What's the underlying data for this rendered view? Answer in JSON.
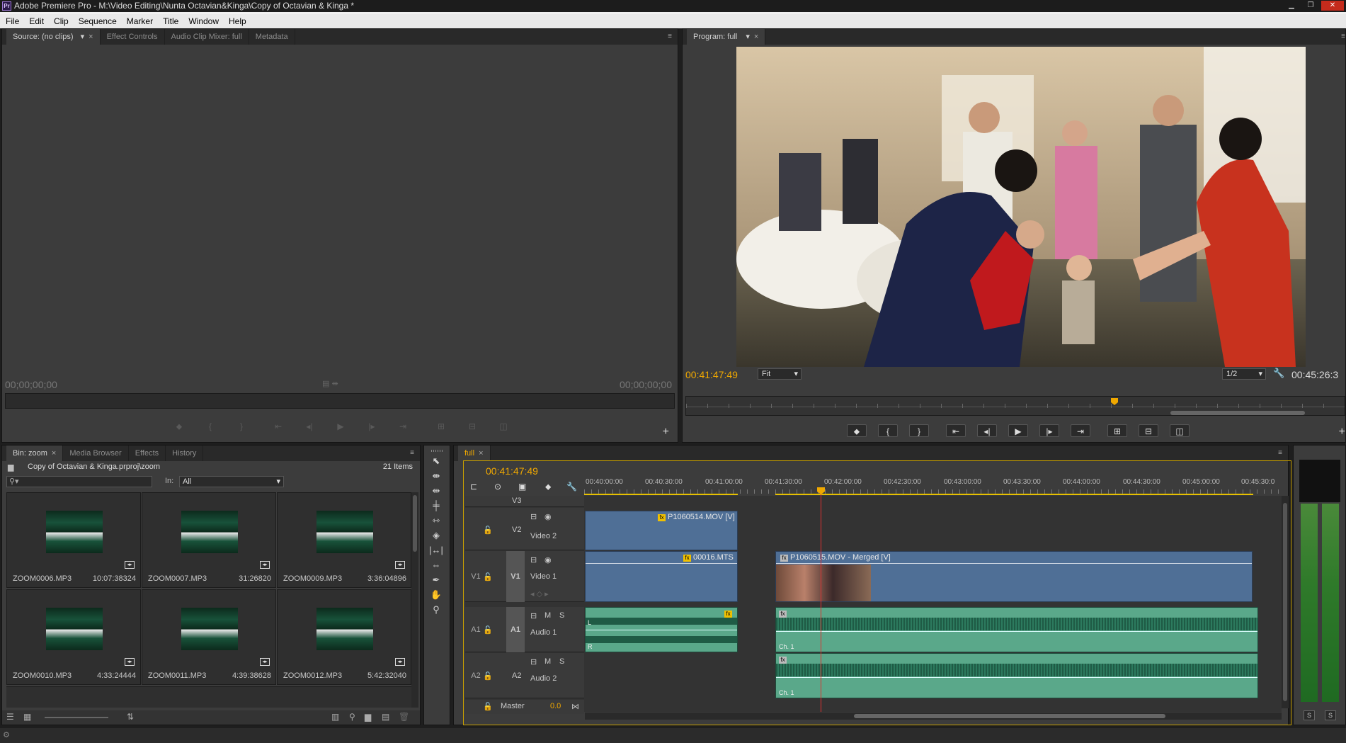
{
  "window": {
    "title": "Adobe Premiere Pro - M:\\Video Editing\\Nunta Octavian&Kinga\\Copy of Octavian & Kinga *",
    "app_icon": "Pr"
  },
  "menu": [
    "File",
    "Edit",
    "Clip",
    "Sequence",
    "Marker",
    "Title",
    "Window",
    "Help"
  ],
  "source_panel": {
    "tabs": [
      {
        "label": "Source: (no clips)"
      },
      {
        "label": "Effect Controls"
      },
      {
        "label": "Audio Clip Mixer: full"
      },
      {
        "label": "Metadata"
      }
    ],
    "tc_left": "00;00;00;00",
    "tc_right": "00;00;00;00"
  },
  "program_panel": {
    "tab": "Program: full",
    "tc_current": "00:41:47:49",
    "zoom": "Fit",
    "resolution": "1/2",
    "tc_duration": "00:45:26:3",
    "playhead_fraction": 0.65
  },
  "project_panel": {
    "tabs": [
      {
        "label": "Bin: zoom"
      },
      {
        "label": "Media Browser"
      },
      {
        "label": "Effects"
      },
      {
        "label": "History"
      }
    ],
    "path": "Copy of Octavian & Kinga.prproj\\zoom",
    "count": "21 Items",
    "in_label": "In:",
    "in_value": "All",
    "items": [
      {
        "name": "ZOOM0006.MP3",
        "duration": "10:07:38324"
      },
      {
        "name": "ZOOM0007.MP3",
        "duration": "31:26820"
      },
      {
        "name": "ZOOM0009.MP3",
        "duration": "3:36:04896"
      },
      {
        "name": "ZOOM0010.MP3",
        "duration": "4:33:24444"
      },
      {
        "name": "ZOOM0011.MP3",
        "duration": "4:39:38628"
      },
      {
        "name": "ZOOM0012.MP3",
        "duration": "5:42:32040"
      }
    ]
  },
  "timeline": {
    "tab": "full",
    "tc": "00:41:47:49",
    "ruler": [
      "00:40:00:00",
      "00:40:30:00",
      "00:41:00:00",
      "00:41:30:00",
      "00:42:00:00",
      "00:42:30:00",
      "00:43:00:00",
      "00:43:30:00",
      "00:44:00:00",
      "00:44:30:00",
      "00:45:00:00",
      "00:45:30:0"
    ],
    "tracks": {
      "v3": "V3",
      "v2": {
        "label": "V2",
        "name": "Video 2"
      },
      "v1": {
        "label": "V1",
        "name": "Video 1",
        "src": "V1"
      },
      "a1": {
        "label": "A1",
        "name": "Audio 1",
        "src": "A1"
      },
      "a2": {
        "label": "A2",
        "name": "Audio 2",
        "src": "A2"
      },
      "master": {
        "name": "Master",
        "value": "0.0"
      }
    },
    "clips": {
      "v2": "P1060514.MOV [V]",
      "v1a": "00016.MTS",
      "v1b": "P1060515.MOV - Merged [V]",
      "fx": "fx",
      "l": "L",
      "r": "R",
      "ch1": "Ch. 1"
    },
    "buttons": {
      "m": "M",
      "s": "S"
    }
  },
  "meter": {
    "s1": "S",
    "s2": "S"
  }
}
